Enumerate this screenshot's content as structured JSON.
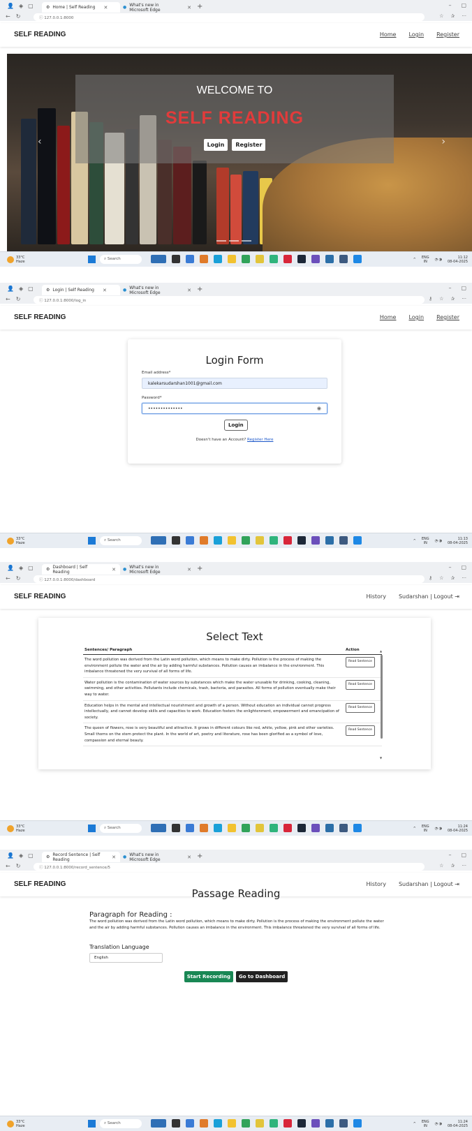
{
  "taskbar": {
    "weather_temp": "33°C",
    "weather_desc": "Haze",
    "search_placeholder": "Search",
    "lang": "ENG",
    "lang_sub": "IN",
    "date": "08-04-2025"
  },
  "screens": [
    {
      "tab_active": "Home | Self Reading",
      "tab_other": "What's new in Microsoft Edge",
      "url": "127.0.0.1:8000",
      "brand": "SELF READING",
      "nav": [
        "Home",
        "Login",
        "Register"
      ],
      "hero": {
        "welcome": "WELCOME TO",
        "brand": "SELF READING",
        "login_btn": "Login",
        "register_btn": "Register"
      },
      "time": "11:12"
    },
    {
      "tab_active": "Login | Self Reading",
      "tab_other": "What's new in Microsoft Edge",
      "url": "127.0.0.1:8000/log_in",
      "brand": "SELF READING",
      "nav": [
        "Home",
        "Login",
        "Register"
      ],
      "form": {
        "title": "Login Form",
        "email_label": "Email address*",
        "email_value": "kalekarsudarshan1001@gmail.com",
        "password_label": "Password*",
        "password_value": "••••••••••••••",
        "login_btn": "Login",
        "no_account": "Doesn't have an Account?",
        "register_link": "Register Here"
      },
      "time": "11:13"
    },
    {
      "tab_active": "Dashboard | Self Reading",
      "tab_other": "What's new in Microsoft Edge",
      "url": "127.0.0.1:8000/dashboard",
      "brand": "SELF READING",
      "nav_history": "History",
      "nav_user": "Sudarshan | Logout",
      "title": "Select Text",
      "col_sentence": "Sentences/ Paragraph",
      "col_action": "Action",
      "action_label": "Read Sentence",
      "rows": [
        "The word pollution was derived from the Latin word pollution, which means to make dirty. Pollution is the process of making the environment pollute the water and the air by adding harmful substances. Pollution causes an imbalance in the environment. This imbalance threatened the very survival of all forms of life.",
        "Water pollution is the contamination of water sources by substances which make the water unusable for drinking, cooking, cleaning, swimming, and other activities. Pollutants include chemicals, trash, bacteria, and parasites. All forms of pollution eventually make their way to water.",
        "Education helps in the mental and intellectual nourishment and growth of a person. Without education an individual cannot progress intellectually, and cannot develop skills and capacities to work. Education fosters the enlightenment, empowerment and emancipation of society.",
        "The queen of flowers, rose is very beautiful and attractive. It grows in different colours like red, white, yellow, pink and other varieties. Small thorns on the stem protect the plant. In the world of art, poetry and literature, rose has been glorified as a symbol of love, compassion and eternal beauty."
      ],
      "time": "11:24"
    },
    {
      "tab_active": "Record Sentence | Self Reading",
      "tab_other": "What's new in Microsoft Edge",
      "url": "127.0.0.1:8000/record_sentence/5",
      "brand": "SELF READING",
      "nav_history": "History",
      "nav_user": "Sudarshan | Logout",
      "title": "Passage Reading",
      "para_heading": "Paragraph for Reading :",
      "para_text": "The word pollution was derived from the Latin word pollution, which means to make dirty. Pollution is the process of making the environment pollute the water and the air by adding harmful substances. Pollution causes an imbalance in the environment. This imbalance threatened the very survival of all forms of life.",
      "translation_label": "Translation Language",
      "translation_value": "English",
      "start_btn": "Start Recording",
      "dash_btn": "Go to Dashboard",
      "time": "11:24"
    }
  ]
}
